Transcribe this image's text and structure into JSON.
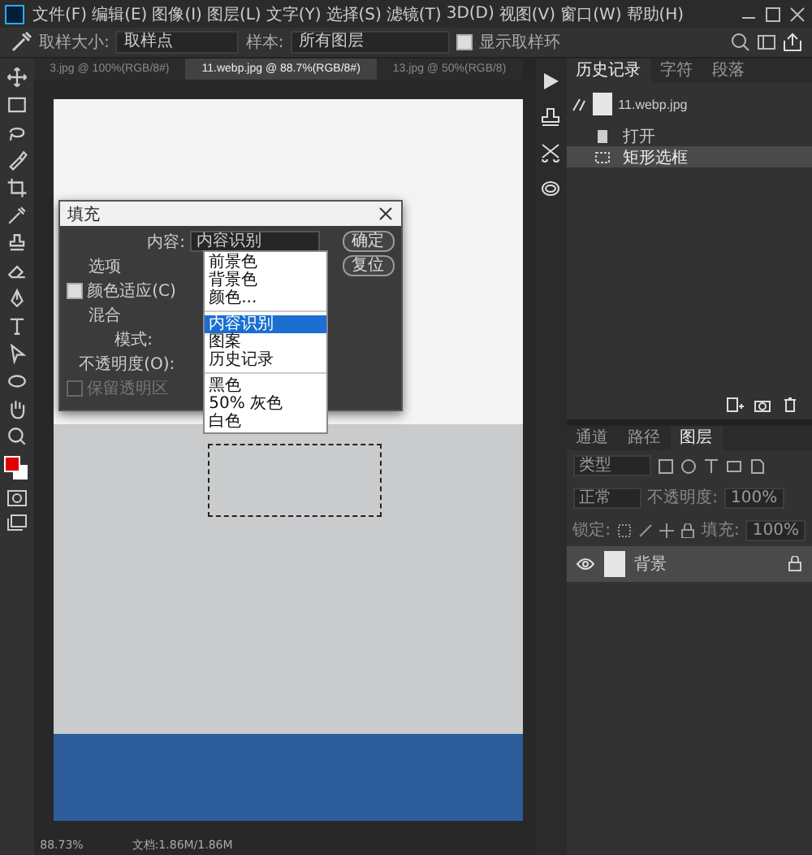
{
  "menu": [
    "文件(F)",
    "编辑(E)",
    "图像(I)",
    "图层(L)",
    "文字(Y)",
    "选择(S)",
    "滤镜(T)",
    "3D(D)",
    "视图(V)",
    "窗口(W)",
    "帮助(H)"
  ],
  "options": {
    "size_label": "取样大小:",
    "size_value": "取样点",
    "sample_label": "样本:",
    "sample_value": "所有图层",
    "show_ring": {
      "label": "显示取样环",
      "checked": true
    }
  },
  "doc_tabs": [
    {
      "label": "3.jpg @ 100%(RGB/8#)",
      "selected": false
    },
    {
      "label": "11.webp.jpg @ 88.7%(RGB/8#)",
      "selected": true
    },
    {
      "label": "13.jpg @ 50%(RGB/8)",
      "selected": false
    }
  ],
  "dialog": {
    "title": "填充",
    "content_label": "内容:",
    "content_value": "内容识别",
    "ok": "确定",
    "reset": "复位",
    "options_label": "选项",
    "color_adapt": {
      "label": "颜色适应(C)",
      "checked": true
    },
    "blend_label": "混合",
    "mode_label": "模式:",
    "opacity_label": "不透明度(O):",
    "preserve": {
      "label": "保留透明区",
      "checked": false,
      "disabled": true
    },
    "dropdown": [
      [
        {
          "label": "前景色",
          "selected": false
        },
        {
          "label": "背景色",
          "selected": false
        },
        {
          "label": "颜色...",
          "selected": false
        }
      ],
      [
        {
          "label": "内容识别",
          "selected": true
        },
        {
          "label": "图案",
          "selected": false
        },
        {
          "label": "历史记录",
          "selected": false
        }
      ],
      [
        {
          "label": "黑色",
          "selected": false
        },
        {
          "label": "50% 灰色",
          "selected": false
        },
        {
          "label": "白色",
          "selected": false
        }
      ]
    ]
  },
  "history": {
    "tabs": [
      {
        "label": "历史记录",
        "selected": true
      },
      {
        "label": "字符",
        "selected": false
      },
      {
        "label": "段落",
        "selected": false
      }
    ],
    "snapshot": "11.webp.jpg",
    "items": [
      {
        "label": "打开",
        "selected": false,
        "kind": "open"
      },
      {
        "label": "矩形选框",
        "selected": true,
        "kind": "marquee"
      }
    ]
  },
  "layers": {
    "tabs": [
      {
        "label": "通道",
        "selected": false
      },
      {
        "label": "路径",
        "selected": false
      },
      {
        "label": "图层",
        "selected": true
      }
    ],
    "filter": "类型",
    "blend": "正常",
    "opacity_label": "不透明度:",
    "opacity": "100%",
    "lock_label": "锁定:",
    "fill_label": "填充:",
    "fill": "100%",
    "items": [
      {
        "name": "背景",
        "visible": true,
        "selected": true,
        "locked": true
      }
    ]
  },
  "status": {
    "zoom": "88.73%",
    "doc": "文档:1.86M/1.86M"
  }
}
